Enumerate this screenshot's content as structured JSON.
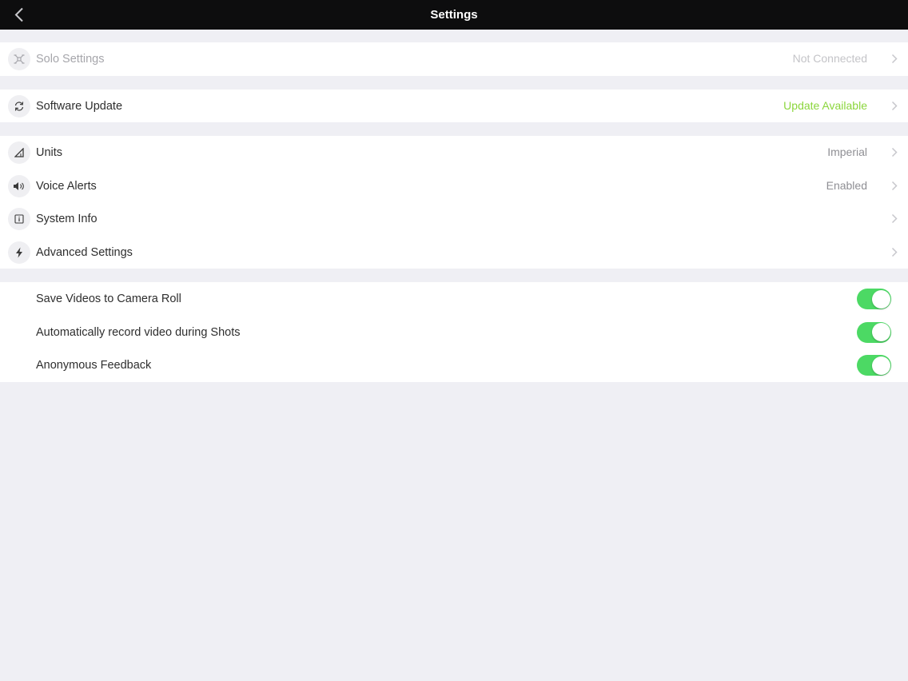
{
  "header": {
    "title": "Settings"
  },
  "groups": {
    "solo": {
      "label": "Solo Settings",
      "value": "Not Connected"
    },
    "update": {
      "label": "Software Update",
      "value": "Update Available",
      "accent_color": "#8bd63c"
    },
    "units": {
      "label": "Units",
      "value": "Imperial"
    },
    "voice": {
      "label": "Voice Alerts",
      "value": "Enabled"
    },
    "sysinfo": {
      "label": "System Info"
    },
    "advanced": {
      "label": "Advanced Settings"
    },
    "toggles": [
      {
        "label": "Save Videos to Camera Roll",
        "on": true
      },
      {
        "label": "Automatically record video during Shots",
        "on": true
      },
      {
        "label": "Anonymous Feedback",
        "on": true
      }
    ]
  },
  "colors": {
    "toggle_on": "#4cd964",
    "navbar_bg": "#0d0d0e",
    "page_bg": "#efeff4"
  },
  "icons": {
    "back": "chevron-left-icon",
    "solo": "drone-icon",
    "update": "refresh-icon",
    "units": "ruler-triangle-icon",
    "voice": "speaker-icon",
    "sysinfo": "info-icon",
    "advanced": "lightning-icon",
    "row_chevron": "chevron-right-icon"
  }
}
